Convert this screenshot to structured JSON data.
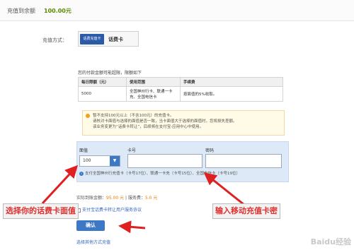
{
  "topbar": {
    "label": "充值到余额",
    "amount": "100.00元"
  },
  "payment": {
    "method_label": "充值方式：",
    "card_logo_text": "话费充值卡",
    "card_name": "话费卡"
  },
  "limit": {
    "title": "您的付款金额可能超限，限额如下",
    "headers": [
      "每日限额（元）",
      "使用范围",
      "手续费"
    ],
    "row": {
      "amount": "5000",
      "scope": "全国神州行卡、联通一卡充、全国电信卡",
      "fee": "按面值的5%收取。"
    }
  },
  "notice": {
    "lines": [
      "暂不支持100元以上（不含100元）的充值卡。",
      "请核对卡面值与选择的面值是否一致，当卡面值大于选择的面值时，您将损失差额。",
      "该业务变更为“话费卡转让”，后续将在支付宝-应用中心中使用。"
    ]
  },
  "form": {
    "denomination_label": "面值",
    "denomination_value": "100",
    "card_number_label": "卡号",
    "password_label": "密码",
    "support_text": "支付全国神州行充值卡（卡号17位）、联通一卡充（卡号15位）、全国电信卡（卡号19位）"
  },
  "amount": {
    "label": "实际到账金额：",
    "value": "95.00 元",
    "fee_label": " | 服务费：",
    "fee_value": "5.0 元"
  },
  "agreement": {
    "text": "支付宝话费卡转让用户服务协议"
  },
  "confirm_button": "确认",
  "other_link": "选择其他方式充值",
  "annotations": {
    "left": "选择你的话费卡面值",
    "right": "输入移动充值卡密",
    "arrow_color": "#e02020"
  },
  "watermark": "Baidu经验"
}
